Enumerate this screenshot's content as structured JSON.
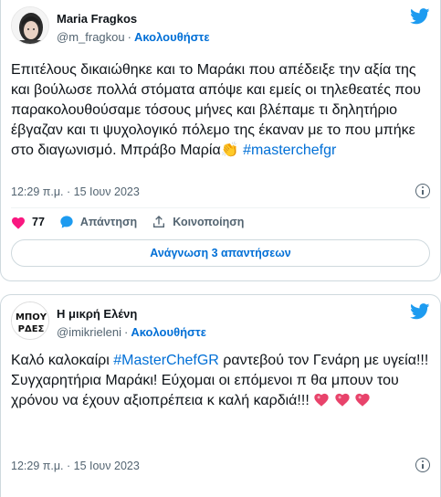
{
  "tweets": [
    {
      "name": "Maria Fragkos",
      "handle": "@m_fragkou",
      "separator": "·",
      "follow_label": "Ακολουθήστε",
      "text_before": "Επιτέλους δικαιώθηκε και το Μαράκι που απέδειξε την αξία της και βούλωσε πολλά στόματα απόψε και εμείς οι τηλεθεατές που παρακολουθούσαμε τόσους μήνες και βλέπαμε τι δηλητήριο έβγαζαν και τι ψυχολογικό πόλεμο της έκαναν με το που μπήκε στο διαγωνισμό. Μπράβο Μαρία",
      "emoji": "👏",
      "hashtag": "#masterchefgr",
      "timestamp": "12:29 π.μ. · 15 Ιουν 2023",
      "like_count": "77",
      "reply_label": "Απάντηση",
      "share_label": "Κοινοποίηση",
      "read_replies_label": "Ανάγνωση 3 απαντήσεων"
    },
    {
      "name": "Η μικρή Ελένη",
      "handle": "@imikrieleni",
      "separator": "·",
      "follow_label": "Ακολουθήστε",
      "avatar_text_line1": "ΜΠΟΥ",
      "avatar_text_line2": "ΡΔΕΣ",
      "text_line1_before": "Καλό καλοκαίρι ",
      "hashtag": "#MasterChefGR",
      "text_line1_after": " ραντεβού τον Γενάρη με υγεία!!!",
      "text_line2": "Συγχαρητήρια Μαράκι! Εύχομαι οι επόμενοι π θα μπουν του χρόνου να έχουν αξιοπρέπεια κ καλή καρδιά!!!",
      "timestamp": "12:29 π.μ. · 15 Ιουν 2023"
    }
  ],
  "colors": {
    "accent": "#006fd6",
    "twitter_blue": "#1d9bf0",
    "like_red": "#f91880",
    "heart": "#e8436b",
    "muted": "#536471",
    "border": "#cfd9de"
  },
  "icons": [
    "twitter-bird-icon",
    "info-icon",
    "heart-icon",
    "speech-bubble-icon",
    "share-upload-icon",
    "sparkling-heart-emoji",
    "clapping-hands-emoji"
  ]
}
